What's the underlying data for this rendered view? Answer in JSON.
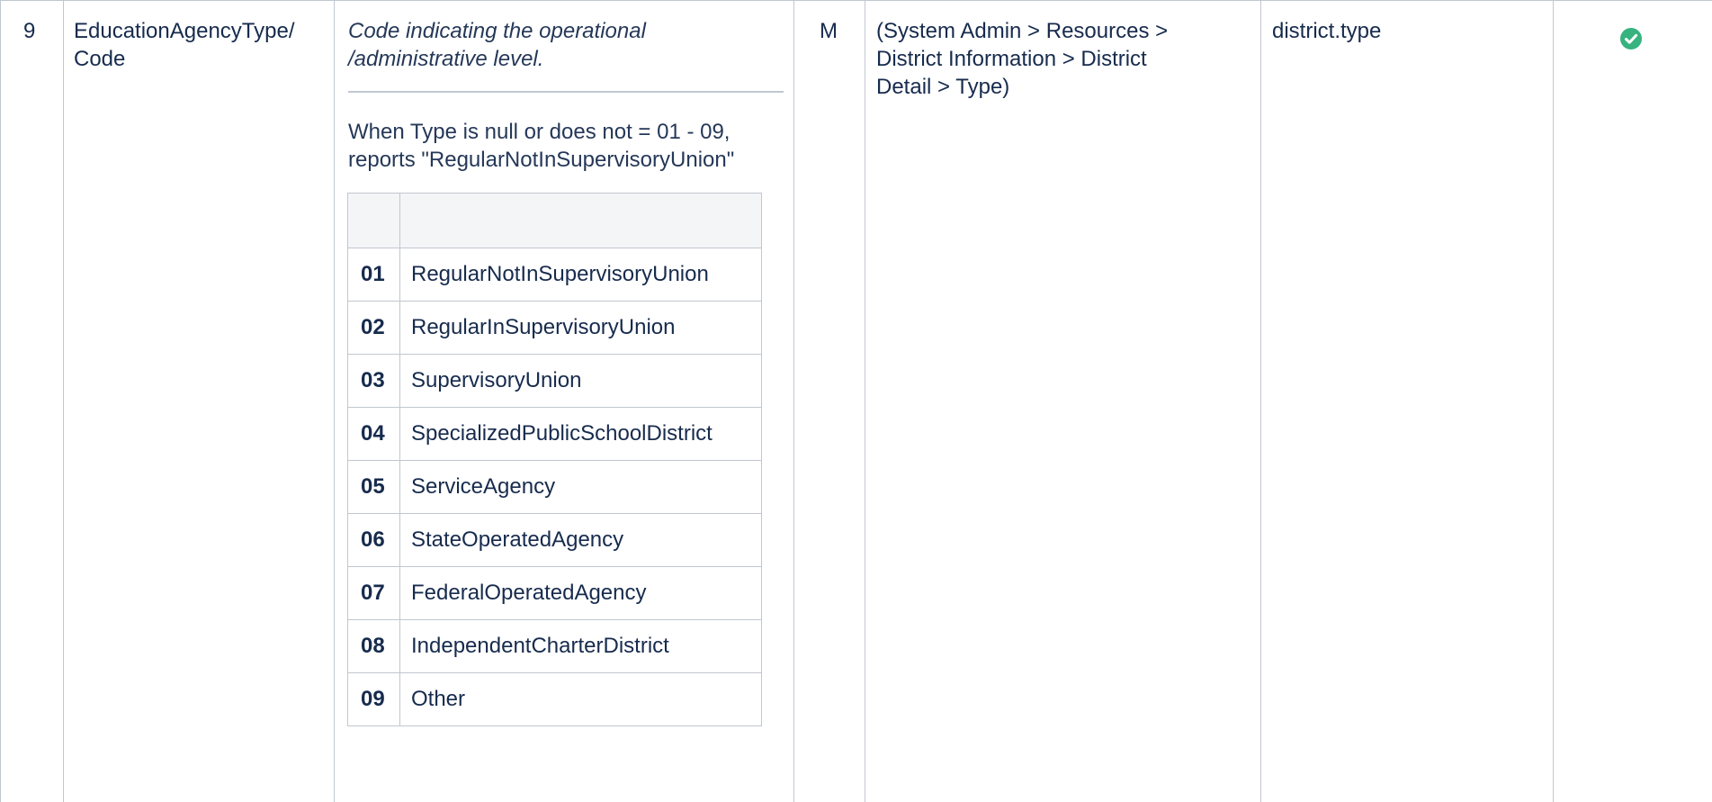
{
  "row": {
    "number": "9",
    "field_name_line1": "EducationAgencyType/",
    "field_name_line2": "Code",
    "description_line1": "Code indicating the operational",
    "description_line2": "/administrative level.",
    "note_line1": "When Type is null or does not = 01 - 09,",
    "note_line2": "reports \"RegularNotInSupervisoryUnion\"",
    "codes": [
      {
        "code": "01",
        "label": "RegularNotInSupervisoryUnion"
      },
      {
        "code": "02",
        "label": "RegularInSupervisoryUnion"
      },
      {
        "code": "03",
        "label": "SupervisoryUnion"
      },
      {
        "code": "04",
        "label": "SpecializedPublicSchoolDistrict"
      },
      {
        "code": "05",
        "label": "ServiceAgency"
      },
      {
        "code": "06",
        "label": "StateOperatedAgency"
      },
      {
        "code": "07",
        "label": "FederalOperatedAgency"
      },
      {
        "code": "08",
        "label": "IndependentCharterDistrict"
      },
      {
        "code": "09",
        "label": "Other"
      }
    ],
    "requirement": "M",
    "ui_path_line1": "(System Admin > Resources >",
    "ui_path_line2": "District Information > District",
    "ui_path_line3": "Detail > Type)",
    "database_field": "district.type",
    "status_icon": "check-circle-icon"
  },
  "colors": {
    "status_green": "#36b37e",
    "border": "#c1c7d0",
    "header_bg": "#f4f5f7"
  }
}
